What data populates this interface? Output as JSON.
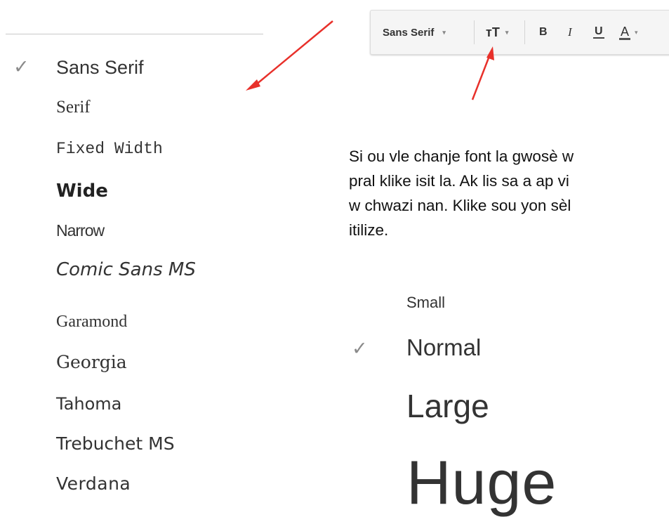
{
  "font_menu": {
    "items": [
      {
        "label": "Sans Serif",
        "selected": true
      },
      {
        "label": "Serif",
        "selected": false
      },
      {
        "label": "Fixed Width",
        "selected": false
      },
      {
        "label": "Wide",
        "selected": false
      },
      {
        "label": "Narrow",
        "selected": false
      },
      {
        "label": "Comic Sans MS",
        "selected": false
      },
      {
        "label": "Garamond",
        "selected": false
      },
      {
        "label": "Georgia",
        "selected": false
      },
      {
        "label": "Tahoma",
        "selected": false
      },
      {
        "label": "Trebuchet MS",
        "selected": false
      },
      {
        "label": "Verdana",
        "selected": false
      }
    ],
    "check_glyph": "✓"
  },
  "toolbar": {
    "font_label": "Sans Serif",
    "caret": "▾",
    "size_icon": "ᴛT",
    "bold": "B",
    "italic": "I",
    "underline": "U",
    "text_color": "A"
  },
  "paragraph": {
    "lines": [
      "Si ou vle chanje font la gwosè w",
      "pral klike isit la. Ak lis sa a ap vi",
      "w chwazi nan. Klike sou yon sèl",
      "itilize."
    ]
  },
  "size_menu": {
    "items": [
      {
        "label": "Small",
        "selected": false
      },
      {
        "label": "Normal",
        "selected": true
      },
      {
        "label": "Large",
        "selected": false
      },
      {
        "label": "Huge",
        "selected": false
      }
    ],
    "check_glyph": "✓"
  },
  "colors": {
    "arrow": "#e8302a",
    "check": "#8a8a8a",
    "divider": "#c9c9c9"
  }
}
